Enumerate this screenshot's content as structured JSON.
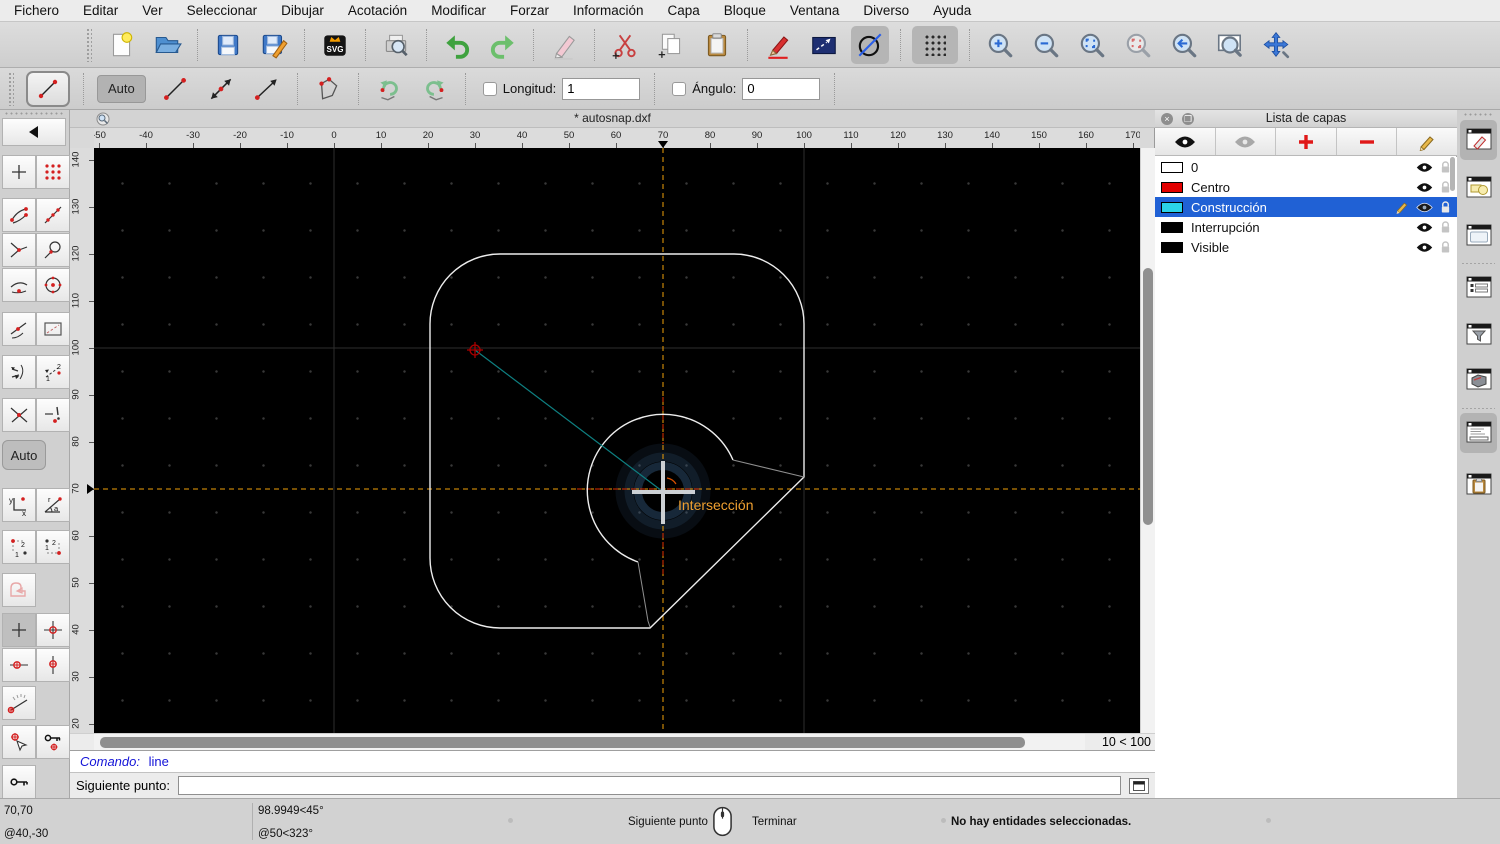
{
  "menubar": {
    "items": [
      "Fichero",
      "Editar",
      "Ver",
      "Seleccionar",
      "Dibujar",
      "Acotación",
      "Modificar",
      "Forzar",
      "Información",
      "Capa",
      "Bloque",
      "Ventana",
      "Diverso",
      "Ayuda"
    ]
  },
  "toolbar_main": {
    "svg_icon_label": "SVG",
    "buttons": [
      "new-file",
      "open-file",
      "save",
      "save-as",
      "svg-export",
      "print-preview",
      "undo",
      "redo",
      "eraser",
      "cut",
      "copy",
      "paste",
      "pen",
      "draw-order",
      "draft-circle",
      "grid-toggle",
      "zoom-in",
      "zoom-out",
      "zoom-auto",
      "zoom-selection",
      "zoom-previous",
      "zoom-window",
      "pan"
    ]
  },
  "tool_options": {
    "selected_tool": "line",
    "auto_label": "Auto",
    "longitud_label": "Longitud:",
    "longitud_value": "1",
    "angulo_label": "Ángulo:",
    "angulo_value": "0",
    "buttons": [
      "line-two-points",
      "line-angle",
      "line-horizontal",
      "polyline",
      "undo-segment",
      "redo-segment"
    ]
  },
  "snap_palette": {
    "auto_label": "Auto",
    "buttons": [
      "back",
      "snap-free",
      "snap-grid",
      "snap-endpoints",
      "snap-on-entity",
      "snap-middle",
      "snap-perpendicular",
      "snap-distance",
      "snap-center",
      "snap-nearest",
      "restrict-to-entity",
      "snap-angles",
      "snap-distance-manual",
      "snap-intersection",
      "snap-intersection-manual",
      "coordinate-cartesian",
      "coordinate-polar",
      "corner-point-1-2",
      "corner-point-2-1",
      "selection-disabled",
      "restrict-nothing",
      "restrict-orthogonal",
      "restrict-horizontal",
      "restrict-vertical",
      "angle-indicator",
      "set-relative-zero",
      "lock-relative-zero",
      "toggle-lock"
    ]
  },
  "document": {
    "title": "* autosnap.dxf",
    "zoom_indicator": "10 < 100",
    "snap_label": "Intersección",
    "ruler": {
      "h_ticks": [
        -50,
        -40,
        -30,
        -20,
        -10,
        0,
        10,
        20,
        30,
        40,
        50,
        60,
        70,
        80,
        90,
        100,
        110,
        120,
        130,
        140,
        150,
        160,
        170
      ],
      "v_ticks": [
        140,
        130,
        120,
        110,
        100,
        90,
        80,
        70,
        60,
        50,
        40,
        30,
        20
      ],
      "h_marker": 70,
      "v_marker": 70
    },
    "command": {
      "prefix": "Comando:",
      "value": "line"
    },
    "prompt": {
      "label": "Siguiente punto:",
      "value": ""
    }
  },
  "layers_panel": {
    "title": "Lista de capas",
    "toolbar": [
      "show-all-layers",
      "hide-all-layers",
      "add-layer",
      "remove-layer",
      "edit-layer"
    ],
    "layers": [
      {
        "name": "0",
        "color": "#ffffff",
        "selected": false
      },
      {
        "name": "Centro",
        "color": "#e20000",
        "selected": false
      },
      {
        "name": "Construcción",
        "color": "#2bd3e8",
        "selected": true
      },
      {
        "name": "Interrupción",
        "color": "#000000",
        "selected": false
      },
      {
        "name": "Visible",
        "color": "#000000",
        "selected": false
      }
    ]
  },
  "right_dock": {
    "buttons": [
      "dock-pen-window",
      "dock-block-list",
      "dock-library-browser",
      "dock-layer-list",
      "dock-layer-filter",
      "dock-wall-view",
      "dock-command-window",
      "dock-clipboard"
    ]
  },
  "statusbar": {
    "coord_abs": "70,70",
    "coord_rel": "@40,-30",
    "polar_abs": "98.9949<45°",
    "polar_rel": "@50<323°",
    "left_click_label": "Siguiente punto",
    "right_click_label": "Terminar",
    "selection_status": "No hay entidades seleccionadas."
  },
  "colors": {
    "selection_blue": "#2061d5",
    "crosshair_orange": "#f0a10a",
    "axis_red": "#e23000",
    "construction_teal": "#0e8082",
    "canvas_black": "#000000"
  }
}
